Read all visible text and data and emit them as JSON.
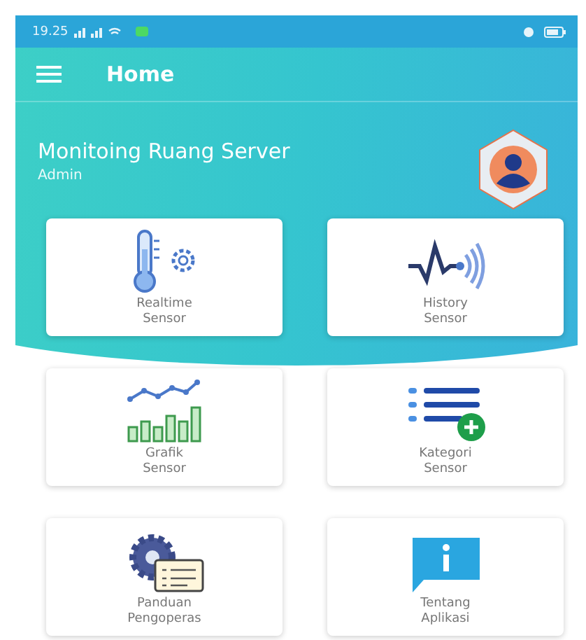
{
  "status_bar": {
    "time": "19.25"
  },
  "app_bar": {
    "title": "Home"
  },
  "header": {
    "title": "Monitoing Ruang Server",
    "subtitle": "Admin"
  },
  "menu": [
    {
      "kind": "thermometer",
      "lines": [
        "Realtime",
        "Sensor"
      ]
    },
    {
      "kind": "signal",
      "lines": [
        "History",
        "Sensor"
      ]
    },
    {
      "kind": "chart",
      "lines": [
        "Grafik",
        "Sensor"
      ]
    },
    {
      "kind": "list",
      "lines": [
        "Kategori",
        "Sensor"
      ]
    },
    {
      "kind": "guide",
      "lines": [
        "Panduan",
        "Pengoperas"
      ]
    },
    {
      "kind": "info",
      "lines": [
        "Tentang",
        "Aplikasi"
      ]
    }
  ]
}
